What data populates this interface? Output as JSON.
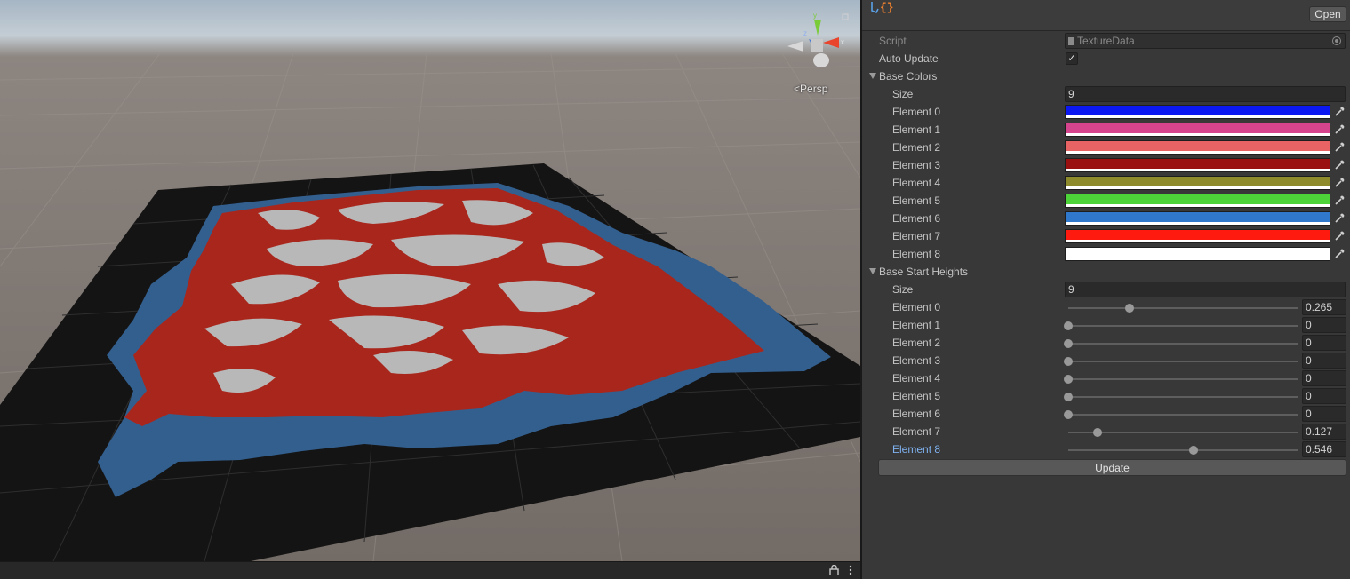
{
  "scene": {
    "view_mode": "Persp",
    "gizmo_axes": {
      "y": "y",
      "x": "x",
      "z": "z"
    }
  },
  "inspector": {
    "asset_icon": "script-braces-icon",
    "open_label": "Open",
    "script": {
      "label": "Script",
      "value": "TextureData"
    },
    "auto_update": {
      "label": "Auto Update",
      "checked": true,
      "check_glyph": "✓"
    },
    "base_colors": {
      "label": "Base Colors",
      "size_label": "Size",
      "size": "9",
      "elements": [
        {
          "label": "Element 0",
          "color": "#0b18f2"
        },
        {
          "label": "Element 1",
          "color": "#d6448e"
        },
        {
          "label": "Element 2",
          "color": "#e86464"
        },
        {
          "label": "Element 3",
          "color": "#9a1010"
        },
        {
          "label": "Element 4",
          "color": "#8e8b2c"
        },
        {
          "label": "Element 5",
          "color": "#4cd439"
        },
        {
          "label": "Element 6",
          "color": "#2f78cc"
        },
        {
          "label": "Element 7",
          "color": "#ff1a10"
        },
        {
          "label": "Element 8",
          "color": "#ffffff"
        }
      ]
    },
    "base_start_heights": {
      "label": "Base Start Heights",
      "size_label": "Size",
      "size": "9",
      "elements": [
        {
          "label": "Element 0",
          "value": "0.265",
          "fraction": 0.265
        },
        {
          "label": "Element 1",
          "value": "0",
          "fraction": 0
        },
        {
          "label": "Element 2",
          "value": "0",
          "fraction": 0
        },
        {
          "label": "Element 3",
          "value": "0",
          "fraction": 0
        },
        {
          "label": "Element 4",
          "value": "0",
          "fraction": 0
        },
        {
          "label": "Element 5",
          "value": "0",
          "fraction": 0
        },
        {
          "label": "Element 6",
          "value": "0",
          "fraction": 0
        },
        {
          "label": "Element 7",
          "value": "0.127",
          "fraction": 0.127
        },
        {
          "label": "Element 8",
          "value": "0.546",
          "fraction": 0.546,
          "selected": true
        }
      ]
    },
    "update_label": "Update"
  }
}
